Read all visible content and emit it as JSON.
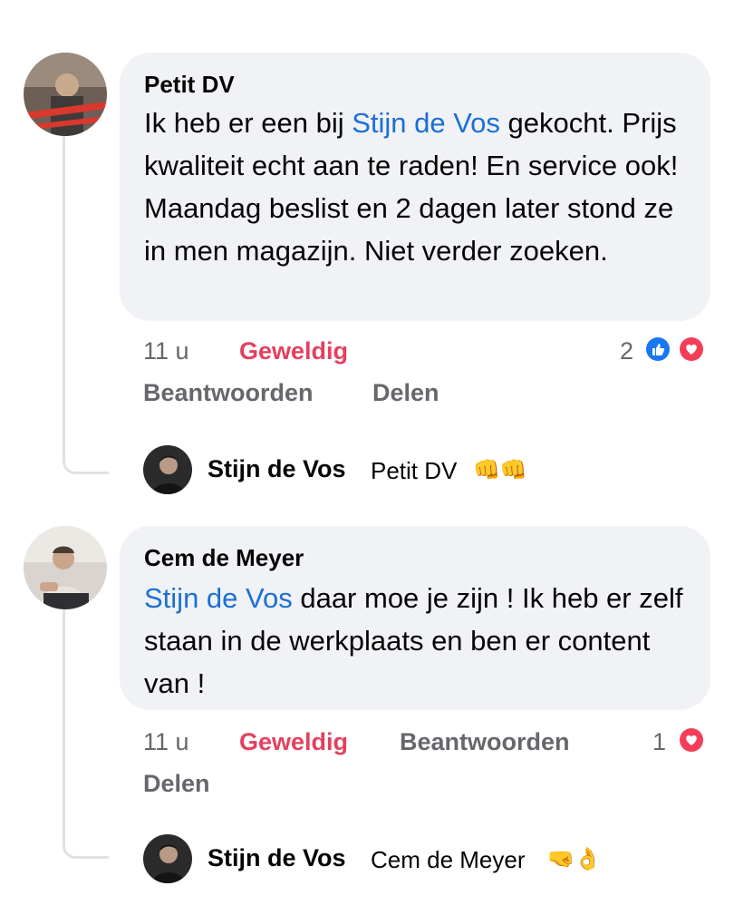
{
  "comments": [
    {
      "author": "Petit DV",
      "text_before": "Ik heb er een bij ",
      "mention": "Stijn de Vos",
      "text_after": " gekocht. Prijs kwaliteit echt aan te raden! En service ook! Maandag beslist en 2 dagen later stond ze in men magazijn. Niet verder zoeken.",
      "time": "11 u",
      "reaction_label": "Geweldig",
      "reply_label": "Beantwoorden",
      "share_label": "Delen",
      "reaction_count": "2",
      "reaction_icons": [
        "like-icon",
        "love-icon"
      ],
      "reply": {
        "author": "Stijn de Vos",
        "text": "Petit DV",
        "emoji": "👊👊"
      }
    },
    {
      "author": "Cem de Meyer",
      "mention": "Stijn de Vos",
      "text_after": "  daar moe je zijn ! Ik heb er zelf staan in de werkplaats en ben er content van !",
      "time": "11 u",
      "reaction_label": "Geweldig",
      "reply_label": "Beantwoorden",
      "share_label": "Delen",
      "reaction_count": "1",
      "reaction_icons": [
        "love-icon"
      ],
      "reply": {
        "author": "Stijn de Vos",
        "text": "Cem de Meyer",
        "emoji": "🤜👌"
      }
    }
  ],
  "colors": {
    "bubble": "#f0f2f5",
    "mention": "#1b6fd6",
    "reaction": "#e4405f",
    "meta": "#65676b",
    "like": "#1877f2",
    "love": "#f33e58"
  }
}
